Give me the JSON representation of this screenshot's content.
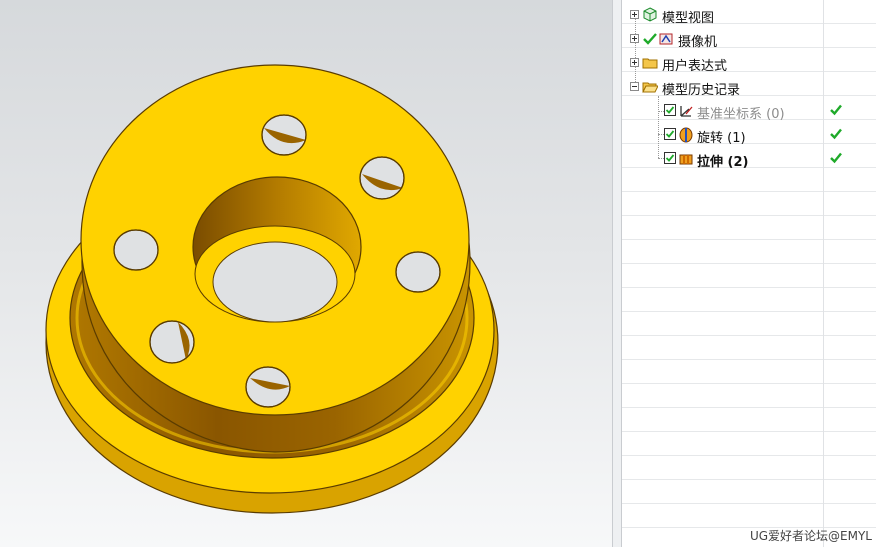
{
  "navigator": {
    "items": [
      {
        "label": "模型视图",
        "icon": "model-view-icon",
        "expander": "+"
      },
      {
        "label": "摄像机",
        "icon": "camera-icon",
        "expander": "+"
      },
      {
        "label": "用户表达式",
        "icon": "folder-icon",
        "expander": "+"
      },
      {
        "label": "模型历史记录",
        "icon": "folder-open-icon",
        "expander": "-"
      }
    ],
    "history": [
      {
        "label": "基准坐标系 (0)",
        "icon": "datum-csys-icon",
        "checked": true,
        "status": "ok"
      },
      {
        "label": "旋转 (1)",
        "icon": "revolve-icon",
        "checked": true,
        "status": "ok"
      },
      {
        "label": "拉伸 (2)",
        "icon": "extrude-icon",
        "checked": true,
        "status": "ok"
      }
    ]
  },
  "watermark": "UG爱好者论坛@EMYL",
  "colors": {
    "part_face": "#ffd200",
    "part_shadow": "#8a5a00",
    "check_green": "#1faa2a"
  }
}
